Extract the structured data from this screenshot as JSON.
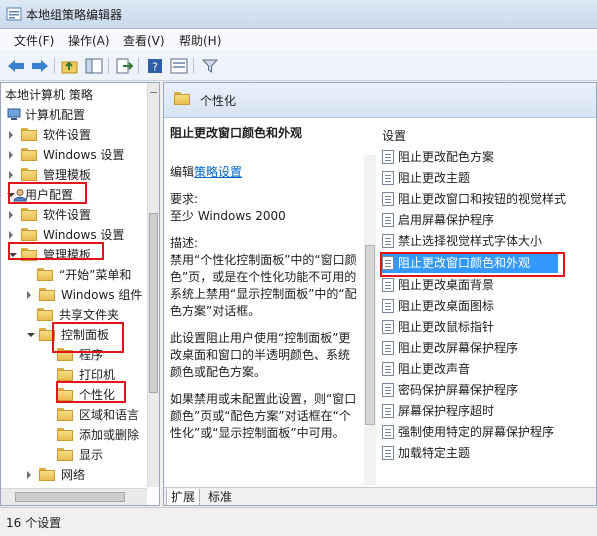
{
  "window": {
    "title": "本地组策略编辑器"
  },
  "menu": [
    "文件(F)",
    "操作(A)",
    "查看(V)",
    "帮助(H)"
  ],
  "toolbar": [
    "back-icon",
    "forward-icon",
    "up-folder-icon",
    "show-hide-tree-icon",
    "export-icon",
    "help-icon",
    "properties-icon",
    "filter-icon"
  ],
  "tree": {
    "root": "本地计算机 策略",
    "items": [
      "计算机配置",
      "软件设置",
      "Windows 设置",
      "管理模板",
      "用户配置",
      "软件设置",
      "Windows 设置",
      "管理模板",
      "“开始”菜单和",
      "Windows 组件",
      "共享文件夹",
      "控制面板",
      "程序",
      "打印机",
      "个性化",
      "区域和语言",
      "添加或删除",
      "显示",
      "网络"
    ]
  },
  "right": {
    "header_title": "个性化",
    "policy_title": "阻止更改窗口颜色和外观",
    "edit_prefix": "编辑",
    "edit_link": "策略设置",
    "requirement_label": "要求:",
    "requirement_value": "至少 Windows 2000",
    "description_label": "描述:",
    "description_p1": "禁用“个性化控制面板”中的“窗口颜色”页，或是在个性化功能不可用的系统上禁用“显示控制面板”中的“配色方案”对话框。",
    "description_p2": "此设置阻止用户使用“控制面板”更改桌面和窗口的半透明颜色、系统颜色或配色方案。",
    "description_p3": "如果禁用或未配置此设置，则“窗口颜色”页或“配色方案”对话框在“个性化”或“显示控制面板”中可用。",
    "list_header": "设置",
    "settings": [
      "阻止更改配色方案",
      "阻止更改主题",
      "阻止更改窗口和按钮的视觉样式",
      "启用屏幕保护程序",
      "禁止选择视觉样式字体大小",
      "阻止更改窗口颜色和外观",
      "阻止更改桌面背景",
      "阻止更改桌面图标",
      "阻止更改鼠标指针",
      "阻止更改屏幕保护程序",
      "阻止更改声音",
      "密码保护屏幕保护程序",
      "屏幕保护程序超时",
      "强制使用特定的屏幕保护程序",
      "加载特定主题"
    ],
    "tabs": [
      "扩展",
      "标准"
    ]
  },
  "status": "16 个设置",
  "colors": {
    "highlight": "#e3131b",
    "selection": "#3399ff"
  }
}
